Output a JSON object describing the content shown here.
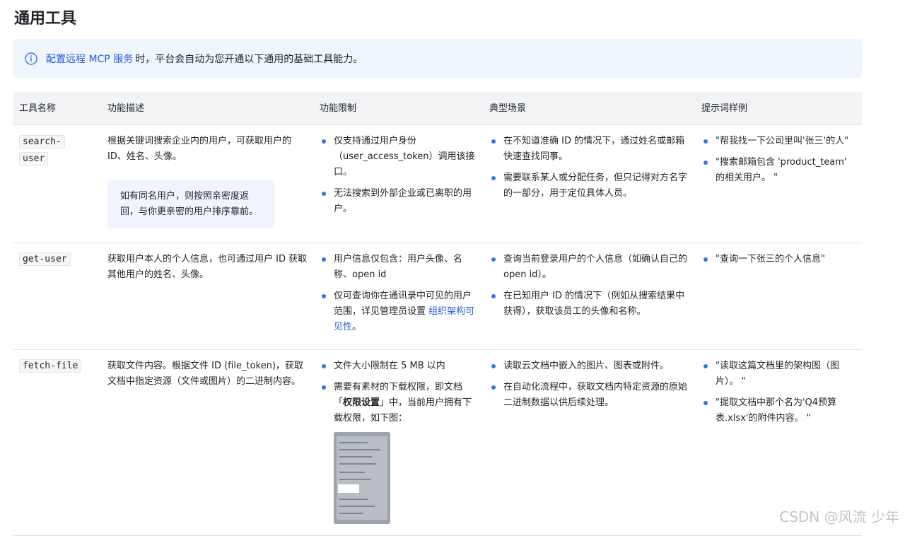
{
  "title": "通用工具",
  "notice": {
    "link_text": "配置远程 MCP 服务",
    "text": "时，平台会自动为您开通以下通用的基础工具能力。",
    "icon": "info-icon"
  },
  "columns": [
    "工具名称",
    "功能描述",
    "功能限制",
    "典型场景",
    "提示词样例"
  ],
  "rows": [
    {
      "tool_a": "search-",
      "tool_b": "user",
      "desc": "根据关键词搜索企业内的用户，可获取用户的 ID、姓名、头像。",
      "tip": "如有同名用户，则按照亲密度返回，与你更亲密的用户排序靠前。",
      "limits": [
        "仅支持通过用户身份（user_access_token）调用该接口。",
        "无法搜索到外部企业或已离职的用户。"
      ],
      "scenarios": [
        "在不知道准确 ID 的情况下，通过姓名或邮箱快速查找同事。",
        "需要联系某人或分配任务，但只记得对方名字的一部分，用于定位具体人员。"
      ],
      "prompts": [
        "\"帮我找一下公司里叫'张三'的人\"",
        "\"搜索邮箱包含 'product_team' 的相关用户。 \""
      ]
    },
    {
      "tool": "get-user",
      "desc": "获取用户本人的个人信息，也可通过用户 ID 获取其他用户的姓名、头像。",
      "limits": [
        "用户信息仅包含：用户头像、名称、open id"
      ],
      "limit2_text": "仅可查询你在通讯录中可见的用户范围，详见管理员设置",
      "limit2_link": "组织架构可见性",
      "limit2_end": "。",
      "scenarios": [
        "查询当前登录用户的个人信息（如确认自己的 open id）。",
        "在已知用户 ID 的情况下（例如从搜索结果中获得），获取该员工的头像和名称。"
      ],
      "prompts": [
        "\"查询一下张三的个人信息\""
      ]
    },
    {
      "tool": "fetch-file",
      "desc": "获取文件内容。根据文件 ID (file_token)，获取文档中指定资源（文件或图片）的二进制内容。",
      "limit1": "文件大小限制在 5 MB 以内",
      "limit2_a": "需要有素材的下载权限，即文档「",
      "limit2_bold": "权限设置",
      "limit2_b": "」中，当前用户拥有下载权限，如下图：",
      "scenarios": [
        "读取云文档中嵌入的图片、图表或附件。",
        "在自动化流程中，获取文档内特定资源的原始二进制数据以供后续处理。"
      ],
      "prompts": [
        "\"读取这篇文档里的架构图（图片）。 \"",
        "\"提取文档中那个名为'Q4预算表.xlsx'的附件内容。 \""
      ]
    }
  ],
  "watermark": "CSDN @风流 少年",
  "colors": {
    "accent": "#245bdb",
    "bullet": "#3370ff",
    "notice_bg": "#eff6fe",
    "header_bg": "#f2f3f5"
  }
}
